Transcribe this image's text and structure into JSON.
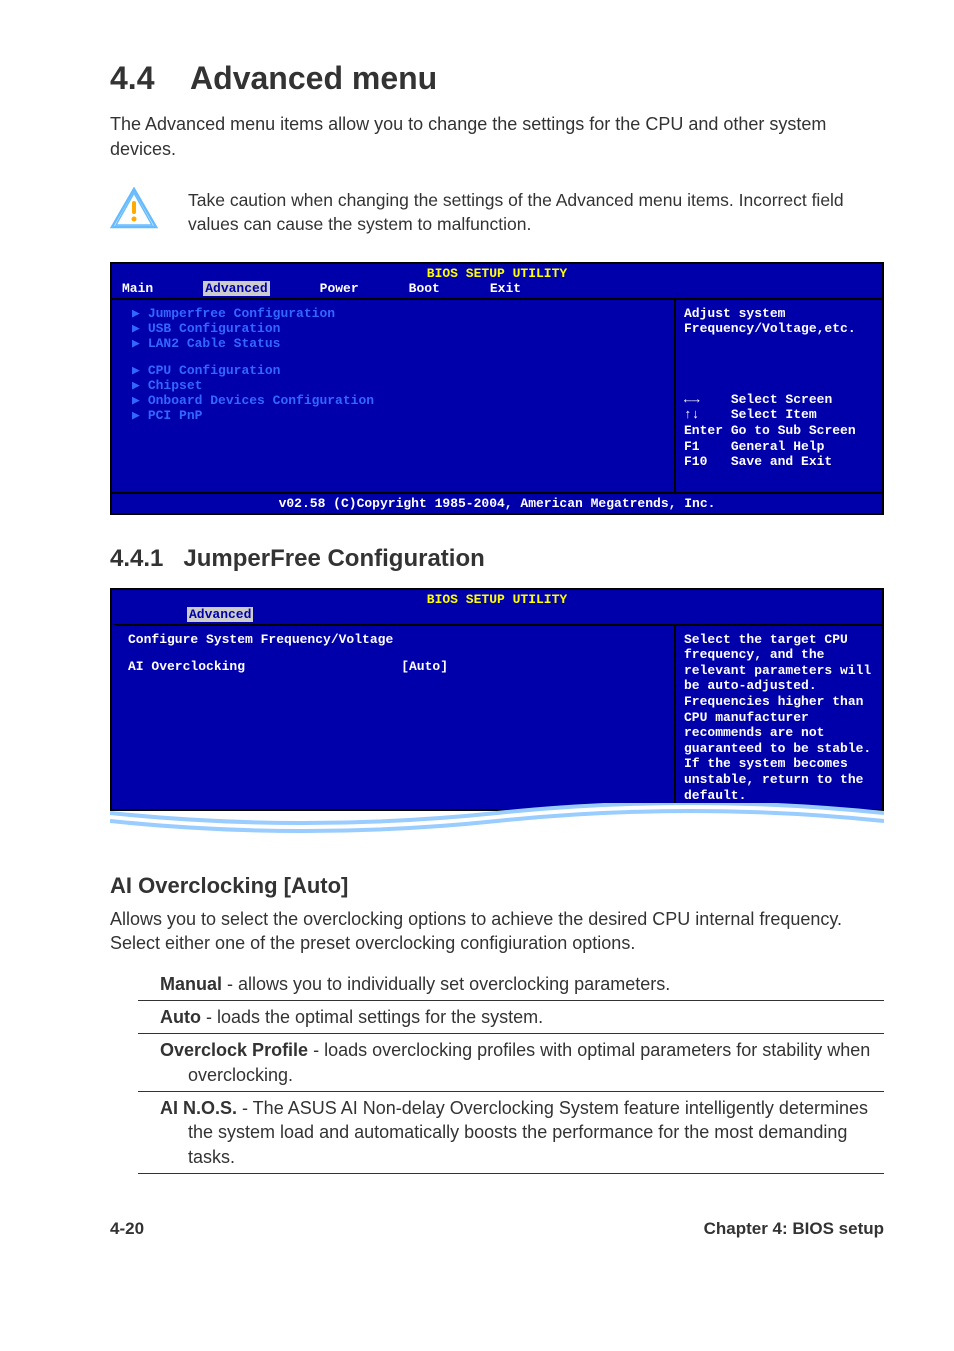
{
  "header": {
    "section_number": "4.4",
    "section_title": "Advanced menu",
    "intro": "The Advanced menu items allow you to change the settings for the CPU and other system devices.",
    "caution": "Take caution when changing the settings of the Advanced menu items. Incorrect field values can cause the system to malfunction."
  },
  "bios1": {
    "title": "BIOS SETUP UTILITY",
    "menus": [
      "Main",
      "Advanced",
      "Power",
      "Boot",
      "Exit"
    ],
    "selected_menu": "Advanced",
    "items_group1": [
      "Jumperfree Configuration",
      "USB Configuration",
      "LAN2 Cable Status"
    ],
    "items_group2": [
      "CPU Configuration",
      "Chipset",
      "Onboard Devices Configuration",
      "PCI PnP"
    ],
    "help_text": "Adjust system Frequency/Voltage,etc.",
    "keys": [
      {
        "key": "←→",
        "label": "Select Screen"
      },
      {
        "key": "↑↓",
        "label": "Select Item"
      },
      {
        "key": "Enter",
        "label": "Go to Sub Screen"
      },
      {
        "key": "F1",
        "label": "General Help"
      },
      {
        "key": "F10",
        "label": "Save and Exit"
      }
    ],
    "footer": "v02.58 (C)Copyright 1985-2004, American Megatrends, Inc."
  },
  "subsection": {
    "number": "4.4.1",
    "title": "JumperFree Configuration"
  },
  "bios2": {
    "title": "BIOS SETUP UTILITY",
    "tab": "Advanced",
    "heading": "Configure System Frequency/Voltage",
    "setting_label": "AI Overclocking",
    "setting_value": "[Auto]",
    "help_text": "Select the target CPU frequency, and the relevant parameters will be auto-adjusted. Frequencies higher than CPU manufacturer recommends are not guaranteed to be stable. If the system becomes unstable, return to the default."
  },
  "ai_overclock": {
    "heading": "AI Overclocking [Auto]",
    "para": "Allows you to select the overclocking options to achieve the desired CPU internal frequency. Select either one of the preset overclocking configiuration options.",
    "options": [
      {
        "name": "Manual",
        "desc": " - allows you to individually set overclocking parameters."
      },
      {
        "name": "Auto",
        "desc": " - loads the optimal settings for the system."
      },
      {
        "name": "Overclock Profile",
        "desc": " - loads overclocking profiles with optimal parameters for stability when overclocking."
      },
      {
        "name": "AI N.O.S.",
        "desc": " - The ASUS AI Non-delay Overclocking System feature intelligently determines the system load and automatically boosts the performance for the most demanding tasks."
      }
    ]
  },
  "footer": {
    "left": "4-20",
    "right": "Chapter 4: BIOS setup"
  }
}
